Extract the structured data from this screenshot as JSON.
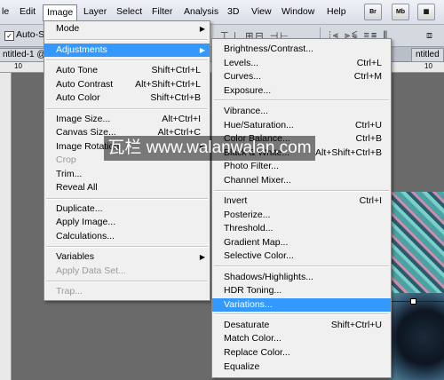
{
  "menubar": {
    "items": [
      "le",
      "Edit",
      "Image",
      "Layer",
      "Select",
      "Filter",
      "Analysis",
      "3D",
      "View",
      "Window",
      "Help"
    ],
    "active": "Image",
    "right_buttons": [
      "Br",
      "Mb"
    ]
  },
  "options_bar": {
    "auto_select_label": "Auto-Se"
  },
  "tabs": {
    "doc1": "ntitled-1 @",
    "doc2": "ntitled"
  },
  "ruler": {
    "left_mark": "10",
    "right_mark": "10"
  },
  "image_menu": {
    "items": [
      {
        "label": "Mode",
        "shortcut": "",
        "submenu": true
      },
      {
        "sep": true
      },
      {
        "label": "Adjustments",
        "shortcut": "",
        "submenu": true,
        "highlight": true
      },
      {
        "sep": true
      },
      {
        "label": "Auto Tone",
        "shortcut": "Shift+Ctrl+L"
      },
      {
        "label": "Auto Contrast",
        "shortcut": "Alt+Shift+Ctrl+L"
      },
      {
        "label": "Auto Color",
        "shortcut": "Shift+Ctrl+B"
      },
      {
        "sep": true
      },
      {
        "label": "Image Size...",
        "shortcut": "Alt+Ctrl+I"
      },
      {
        "label": "Canvas Size...",
        "shortcut": "Alt+Ctrl+C"
      },
      {
        "label": "Image Rotation",
        "shortcut": "",
        "submenu": true
      },
      {
        "label": "Crop",
        "shortcut": "",
        "disabled": true
      },
      {
        "label": "Trim...",
        "shortcut": ""
      },
      {
        "label": "Reveal All",
        "shortcut": ""
      },
      {
        "sep": true
      },
      {
        "label": "Duplicate...",
        "shortcut": ""
      },
      {
        "label": "Apply Image...",
        "shortcut": ""
      },
      {
        "label": "Calculations...",
        "shortcut": ""
      },
      {
        "sep": true
      },
      {
        "label": "Variables",
        "shortcut": "",
        "submenu": true
      },
      {
        "label": "Apply Data Set...",
        "shortcut": "",
        "disabled": true
      },
      {
        "sep": true
      },
      {
        "label": "Trap...",
        "shortcut": "",
        "disabled": true
      }
    ]
  },
  "adjustments_menu": {
    "items": [
      {
        "label": "Brightness/Contrast...",
        "shortcut": ""
      },
      {
        "label": "Levels...",
        "shortcut": "Ctrl+L"
      },
      {
        "label": "Curves...",
        "shortcut": "Ctrl+M"
      },
      {
        "label": "Exposure...",
        "shortcut": ""
      },
      {
        "sep": true
      },
      {
        "label": "Vibrance...",
        "shortcut": ""
      },
      {
        "label": "Hue/Saturation...",
        "shortcut": "Ctrl+U"
      },
      {
        "label": "Color Balance...",
        "shortcut": "Ctrl+B"
      },
      {
        "label": "Black & White...",
        "shortcut": "Alt+Shift+Ctrl+B"
      },
      {
        "label": "Photo Filter...",
        "shortcut": ""
      },
      {
        "label": "Channel Mixer...",
        "shortcut": ""
      },
      {
        "sep": true
      },
      {
        "label": "Invert",
        "shortcut": "Ctrl+I"
      },
      {
        "label": "Posterize...",
        "shortcut": ""
      },
      {
        "label": "Threshold...",
        "shortcut": ""
      },
      {
        "label": "Gradient Map...",
        "shortcut": ""
      },
      {
        "label": "Selective Color...",
        "shortcut": ""
      },
      {
        "sep": true
      },
      {
        "label": "Shadows/Highlights...",
        "shortcut": ""
      },
      {
        "label": "HDR Toning...",
        "shortcut": ""
      },
      {
        "label": "Variations...",
        "shortcut": "",
        "highlight": true
      },
      {
        "sep": true
      },
      {
        "label": "Desaturate",
        "shortcut": "Shift+Ctrl+U"
      },
      {
        "label": "Match Color...",
        "shortcut": ""
      },
      {
        "label": "Replace Color...",
        "shortcut": ""
      },
      {
        "label": "Equalize",
        "shortcut": ""
      }
    ]
  },
  "watermark": "瓦栏 www.walanwalan.com",
  "colors": {
    "highlight": "#3399ff",
    "menu_bg": "#f0f0f0",
    "disabled_text": "#9a9a9a"
  }
}
